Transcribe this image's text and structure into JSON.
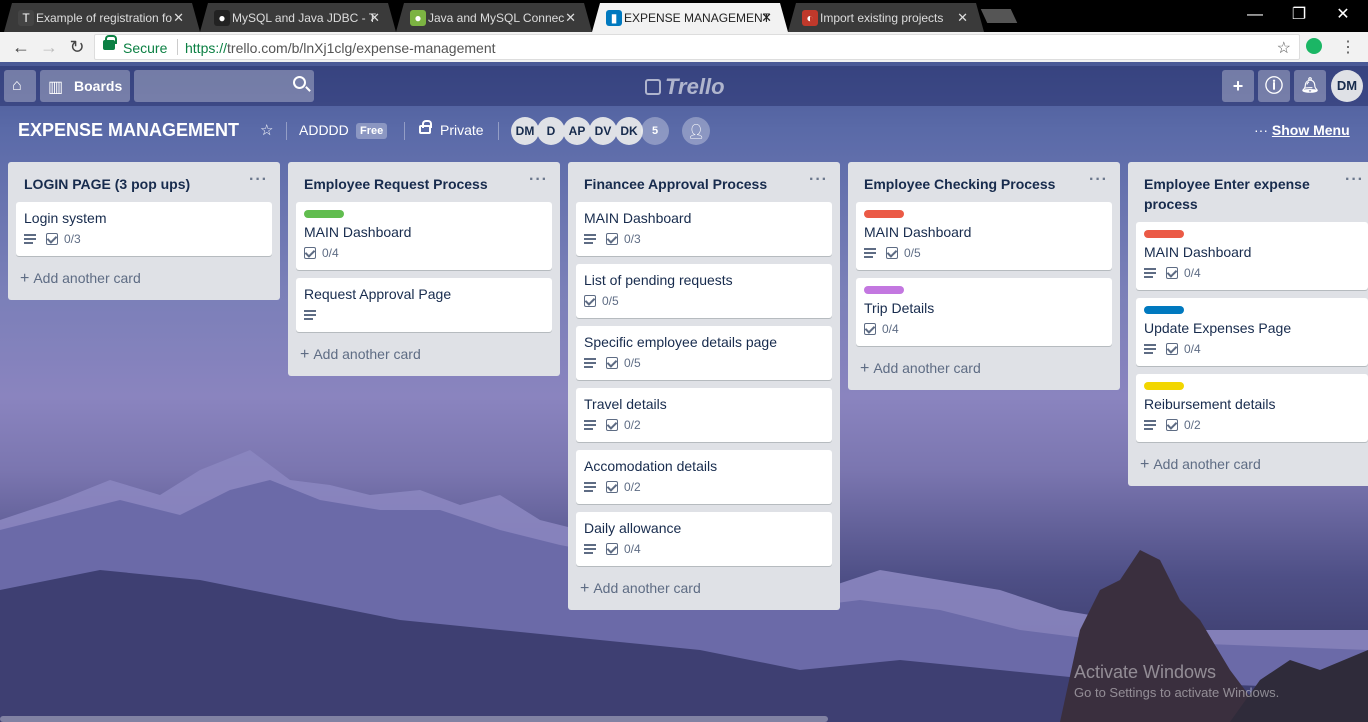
{
  "browser": {
    "tabs": [
      {
        "title": "Example of registration fo",
        "icon": "T",
        "icon_bg": "#444444",
        "active": false
      },
      {
        "title": "MySQL and Java JDBC - T",
        "icon": "●",
        "icon_bg": "#222222",
        "active": false
      },
      {
        "title": "Java and MySQL Connec",
        "icon": "●",
        "icon_bg": "#7cb342",
        "active": false
      },
      {
        "title": "EXPENSE MANAGEMENT",
        "icon": "▮",
        "icon_bg": "#0079bf",
        "active": true
      },
      {
        "title": "Import existing projects",
        "icon": "◐",
        "icon_bg": "#c0392b",
        "active": false
      }
    ],
    "secure_label": "Secure",
    "url_scheme": "https://",
    "url_rest": "trello.com/b/lnXj1clg/expense-management"
  },
  "header": {
    "boards_label": "Boards",
    "logo_text": "Trello",
    "user_initials": "DM"
  },
  "board": {
    "title": "EXPENSE MANAGEMENT",
    "team": "ADDDD",
    "team_badge": "Free",
    "visibility": "Private",
    "members": [
      "DM",
      "D",
      "AP",
      "DV",
      "DK"
    ],
    "member_count": "5",
    "show_menu": "Show Menu"
  },
  "add_card_label": "Add another card",
  "labels": {
    "green": "#61bd4f",
    "red": "#eb5a46",
    "purple": "#c377e0",
    "blue": "#0079bf",
    "yellow": "#f2d600"
  },
  "lists": [
    {
      "title": "LOGIN PAGE (3 pop ups)",
      "cards": [
        {
          "title": "Login system",
          "desc": true,
          "checklist": "0/3"
        }
      ]
    },
    {
      "title": "Employee Request Process",
      "cards": [
        {
          "title": "MAIN Dashboard",
          "label": "green",
          "desc": false,
          "checklist": "0/4"
        },
        {
          "title": "Request Approval Page",
          "desc": true,
          "checklist": ""
        }
      ]
    },
    {
      "title": "Financee Approval Process",
      "cards": [
        {
          "title": "MAIN Dashboard",
          "desc": true,
          "checklist": "0/3"
        },
        {
          "title": "List of pending requests",
          "desc": false,
          "checklist": "0/5"
        },
        {
          "title": "Specific employee details page",
          "desc": true,
          "checklist": "0/5"
        },
        {
          "title": "Travel details",
          "desc": true,
          "checklist": "0/2"
        },
        {
          "title": "Accomodation details",
          "desc": true,
          "checklist": "0/2"
        },
        {
          "title": "Daily allowance",
          "desc": true,
          "checklist": "0/4"
        }
      ]
    },
    {
      "title": "Employee Checking Process",
      "cards": [
        {
          "title": "MAIN Dashboard",
          "label": "red",
          "desc": true,
          "checklist": "0/5"
        },
        {
          "title": "Trip Details",
          "label": "purple",
          "desc": false,
          "checklist": "0/4"
        }
      ]
    },
    {
      "title": "Employee Enter expense process",
      "cards": [
        {
          "title": "MAIN Dashboard",
          "label": "red",
          "desc": true,
          "checklist": "0/4"
        },
        {
          "title": "Update Expenses Page",
          "label": "blue",
          "desc": true,
          "checklist": "0/4"
        },
        {
          "title": "Reibursement details",
          "label": "yellow",
          "desc": true,
          "checklist": "0/2"
        }
      ]
    }
  ],
  "watermark": {
    "line1": "Activate Windows",
    "line2": "Go to Settings to activate Windows."
  }
}
